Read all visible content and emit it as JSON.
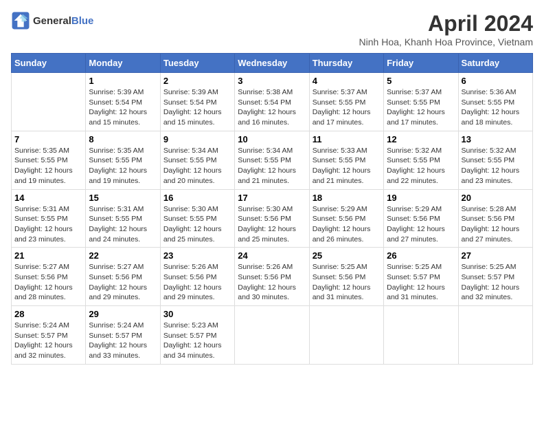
{
  "header": {
    "logo_line1": "General",
    "logo_line2": "Blue",
    "month_year": "April 2024",
    "location": "Ninh Hoa, Khanh Hoa Province, Vietnam"
  },
  "weekdays": [
    "Sunday",
    "Monday",
    "Tuesday",
    "Wednesday",
    "Thursday",
    "Friday",
    "Saturday"
  ],
  "weeks": [
    [
      {
        "day": "",
        "info": ""
      },
      {
        "day": "1",
        "info": "Sunrise: 5:39 AM\nSunset: 5:54 PM\nDaylight: 12 hours\nand 15 minutes."
      },
      {
        "day": "2",
        "info": "Sunrise: 5:39 AM\nSunset: 5:54 PM\nDaylight: 12 hours\nand 15 minutes."
      },
      {
        "day": "3",
        "info": "Sunrise: 5:38 AM\nSunset: 5:54 PM\nDaylight: 12 hours\nand 16 minutes."
      },
      {
        "day": "4",
        "info": "Sunrise: 5:37 AM\nSunset: 5:55 PM\nDaylight: 12 hours\nand 17 minutes."
      },
      {
        "day": "5",
        "info": "Sunrise: 5:37 AM\nSunset: 5:55 PM\nDaylight: 12 hours\nand 17 minutes."
      },
      {
        "day": "6",
        "info": "Sunrise: 5:36 AM\nSunset: 5:55 PM\nDaylight: 12 hours\nand 18 minutes."
      }
    ],
    [
      {
        "day": "7",
        "info": "Sunrise: 5:35 AM\nSunset: 5:55 PM\nDaylight: 12 hours\nand 19 minutes."
      },
      {
        "day": "8",
        "info": "Sunrise: 5:35 AM\nSunset: 5:55 PM\nDaylight: 12 hours\nand 19 minutes."
      },
      {
        "day": "9",
        "info": "Sunrise: 5:34 AM\nSunset: 5:55 PM\nDaylight: 12 hours\nand 20 minutes."
      },
      {
        "day": "10",
        "info": "Sunrise: 5:34 AM\nSunset: 5:55 PM\nDaylight: 12 hours\nand 21 minutes."
      },
      {
        "day": "11",
        "info": "Sunrise: 5:33 AM\nSunset: 5:55 PM\nDaylight: 12 hours\nand 21 minutes."
      },
      {
        "day": "12",
        "info": "Sunrise: 5:32 AM\nSunset: 5:55 PM\nDaylight: 12 hours\nand 22 minutes."
      },
      {
        "day": "13",
        "info": "Sunrise: 5:32 AM\nSunset: 5:55 PM\nDaylight: 12 hours\nand 23 minutes."
      }
    ],
    [
      {
        "day": "14",
        "info": "Sunrise: 5:31 AM\nSunset: 5:55 PM\nDaylight: 12 hours\nand 23 minutes."
      },
      {
        "day": "15",
        "info": "Sunrise: 5:31 AM\nSunset: 5:55 PM\nDaylight: 12 hours\nand 24 minutes."
      },
      {
        "day": "16",
        "info": "Sunrise: 5:30 AM\nSunset: 5:55 PM\nDaylight: 12 hours\nand 25 minutes."
      },
      {
        "day": "17",
        "info": "Sunrise: 5:30 AM\nSunset: 5:56 PM\nDaylight: 12 hours\nand 25 minutes."
      },
      {
        "day": "18",
        "info": "Sunrise: 5:29 AM\nSunset: 5:56 PM\nDaylight: 12 hours\nand 26 minutes."
      },
      {
        "day": "19",
        "info": "Sunrise: 5:29 AM\nSunset: 5:56 PM\nDaylight: 12 hours\nand 27 minutes."
      },
      {
        "day": "20",
        "info": "Sunrise: 5:28 AM\nSunset: 5:56 PM\nDaylight: 12 hours\nand 27 minutes."
      }
    ],
    [
      {
        "day": "21",
        "info": "Sunrise: 5:27 AM\nSunset: 5:56 PM\nDaylight: 12 hours\nand 28 minutes."
      },
      {
        "day": "22",
        "info": "Sunrise: 5:27 AM\nSunset: 5:56 PM\nDaylight: 12 hours\nand 29 minutes."
      },
      {
        "day": "23",
        "info": "Sunrise: 5:26 AM\nSunset: 5:56 PM\nDaylight: 12 hours\nand 29 minutes."
      },
      {
        "day": "24",
        "info": "Sunrise: 5:26 AM\nSunset: 5:56 PM\nDaylight: 12 hours\nand 30 minutes."
      },
      {
        "day": "25",
        "info": "Sunrise: 5:25 AM\nSunset: 5:56 PM\nDaylight: 12 hours\nand 31 minutes."
      },
      {
        "day": "26",
        "info": "Sunrise: 5:25 AM\nSunset: 5:57 PM\nDaylight: 12 hours\nand 31 minutes."
      },
      {
        "day": "27",
        "info": "Sunrise: 5:25 AM\nSunset: 5:57 PM\nDaylight: 12 hours\nand 32 minutes."
      }
    ],
    [
      {
        "day": "28",
        "info": "Sunrise: 5:24 AM\nSunset: 5:57 PM\nDaylight: 12 hours\nand 32 minutes."
      },
      {
        "day": "29",
        "info": "Sunrise: 5:24 AM\nSunset: 5:57 PM\nDaylight: 12 hours\nand 33 minutes."
      },
      {
        "day": "30",
        "info": "Sunrise: 5:23 AM\nSunset: 5:57 PM\nDaylight: 12 hours\nand 34 minutes."
      },
      {
        "day": "",
        "info": ""
      },
      {
        "day": "",
        "info": ""
      },
      {
        "day": "",
        "info": ""
      },
      {
        "day": "",
        "info": ""
      }
    ]
  ]
}
